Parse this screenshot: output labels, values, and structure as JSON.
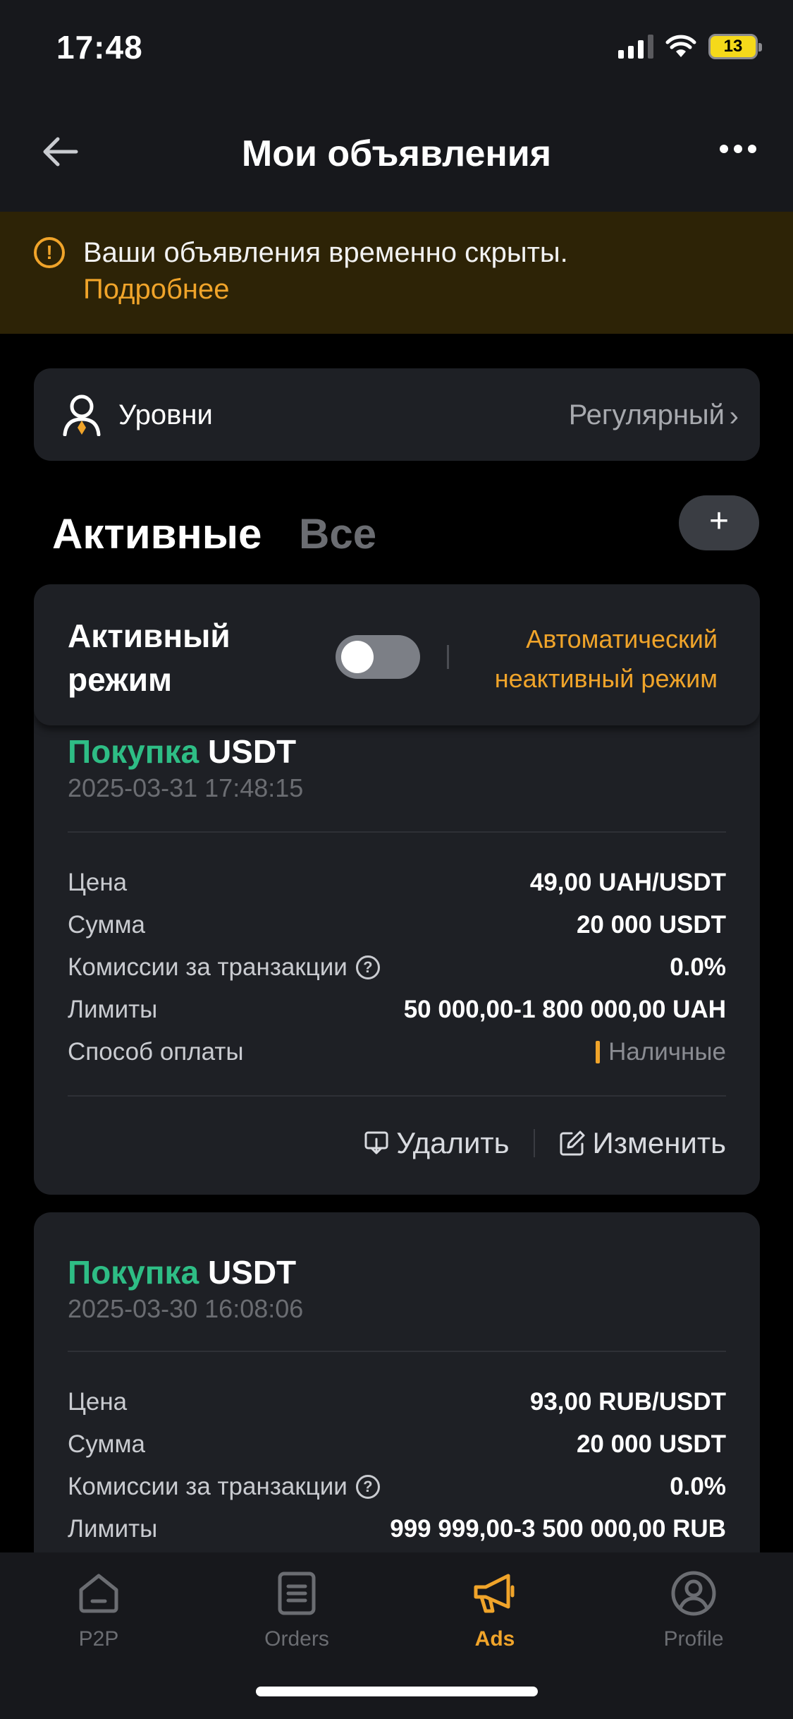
{
  "status_bar": {
    "time": "17:48",
    "battery": "13"
  },
  "header": {
    "title": "Мои объявления"
  },
  "notice": {
    "text": "Ваши объявления временно скрыты.",
    "link": "Подробнее"
  },
  "levels": {
    "label": "Уровни",
    "value": "Регулярный"
  },
  "tabs": {
    "active": "Активные",
    "all": "Все"
  },
  "mode": {
    "label_line1": "Активный",
    "label_line2": "режим",
    "auto_line1": "Автоматический",
    "auto_line2": "неактивный режим",
    "toggle_on": false
  },
  "ads": [
    {
      "side": "Покупка",
      "asset": "USDT",
      "date": "2025-03-31 17:48:15",
      "rows": [
        {
          "label": "Цена",
          "value": "49,00 UAH/USDT"
        },
        {
          "label": "Сумма",
          "value": "20 000 USDT"
        },
        {
          "label": "Комиссии за транзакции",
          "value": "0.0%"
        },
        {
          "label": "Лимиты",
          "value": "50 000,00-1 800 000,00 UAH"
        },
        {
          "label": "Способ оплаты",
          "value": "Наличные"
        }
      ],
      "delete_label": "Удалить",
      "edit_label": "Изменить"
    },
    {
      "side": "Покупка",
      "asset": "USDT",
      "date": "2025-03-30 16:08:06",
      "rows": [
        {
          "label": "Цена",
          "value": "93,00 RUB/USDT"
        },
        {
          "label": "Сумма",
          "value": "20 000 USDT"
        },
        {
          "label": "Комиссии за транзакции",
          "value": "0.0%"
        },
        {
          "label": "Лимиты",
          "value": "999 999,00-3 500 000,00 RUB"
        }
      ]
    }
  ],
  "nav": [
    {
      "label": "P2P",
      "icon": "home-icon"
    },
    {
      "label": "Orders",
      "icon": "orders-icon"
    },
    {
      "label": "Ads",
      "icon": "megaphone-icon",
      "active": true
    },
    {
      "label": "Profile",
      "icon": "profile-icon"
    }
  ],
  "colors": {
    "accent": "#f0a42a",
    "buy": "#2ebd85",
    "background": "#000000",
    "card": "#1e2025"
  }
}
